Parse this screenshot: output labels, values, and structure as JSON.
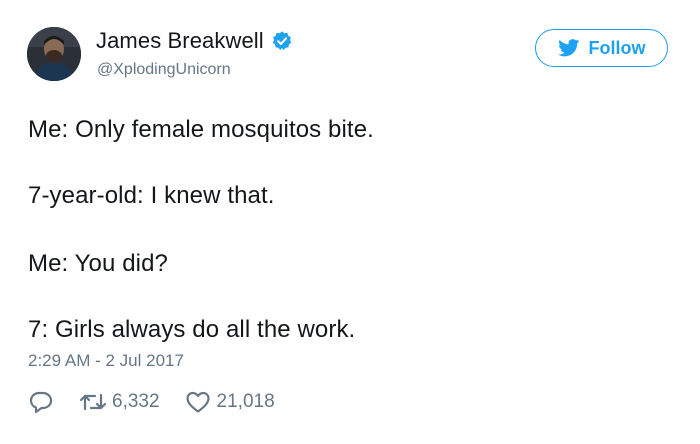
{
  "author": {
    "name": "James Breakwell",
    "handle": "@XplodingUnicorn",
    "verified": true
  },
  "follow_button": {
    "label": "Follow"
  },
  "tweet": {
    "lines": [
      "Me: Only female mosquitos bite.",
      "7-year-old: I knew that.",
      "Me: You did?",
      "7: Girls always do all the work."
    ],
    "timestamp": "2:29 AM - 2 Jul 2017"
  },
  "stats": {
    "retweets": "6,332",
    "likes": "21,018"
  },
  "colors": {
    "accent": "#1da1f2",
    "text": "#14171a",
    "muted": "#657786"
  },
  "icons": [
    "verified-badge-icon",
    "twitter-bird-icon",
    "reply-icon",
    "retweet-icon",
    "like-heart-icon"
  ]
}
